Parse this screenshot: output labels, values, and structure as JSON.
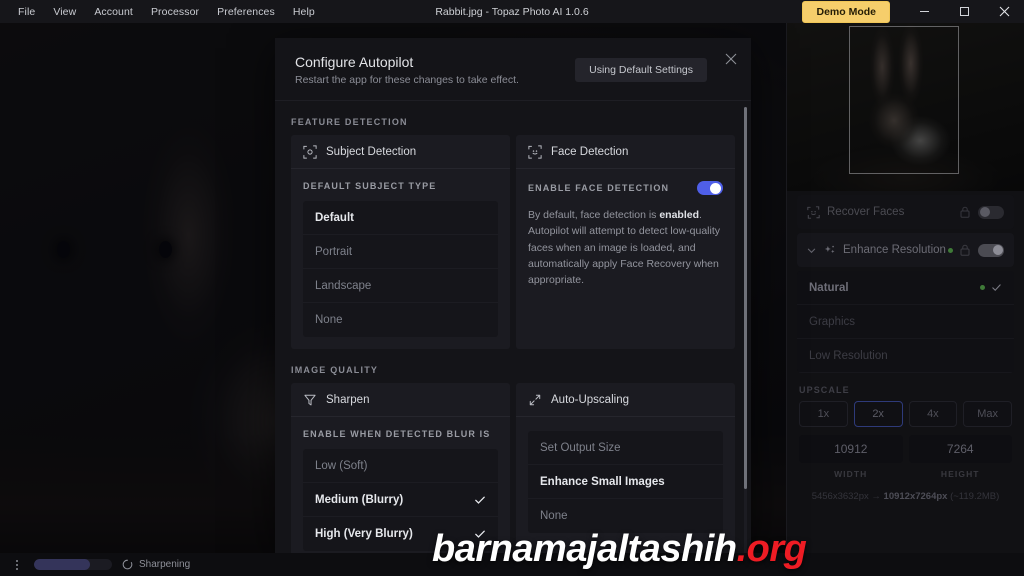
{
  "titlebar": {
    "menu": [
      "File",
      "View",
      "Account",
      "Processor",
      "Preferences",
      "Help"
    ],
    "window_title": "Rabbit.jpg - Topaz Photo AI 1.0.6",
    "demo_button": "Demo Mode",
    "minimize_icon": "minimize-icon",
    "maximize_icon": "maximize-icon",
    "close_icon": "close-icon"
  },
  "dialog": {
    "title": "Configure Autopilot",
    "subtitle": "Restart the app for these changes to take effect.",
    "default_settings_button": "Using Default Settings",
    "close_icon": "close-icon",
    "sections": {
      "feature_detection_label": "FEATURE DETECTION",
      "image_quality_label": "IMAGE QUALITY"
    },
    "subject_detection": {
      "icon": "subject-detection-icon",
      "title": "Subject Detection",
      "field_label": "DEFAULT SUBJECT TYPE",
      "options": [
        {
          "label": "Default",
          "selected": true
        },
        {
          "label": "Portrait",
          "selected": false
        },
        {
          "label": "Landscape",
          "selected": false
        },
        {
          "label": "None",
          "selected": false
        }
      ]
    },
    "face_detection": {
      "icon": "face-detection-icon",
      "title": "Face Detection",
      "field_label": "ENABLE FACE DETECTION",
      "toggle_on": true,
      "description_pre": "By default, face detection is ",
      "description_bold": "enabled",
      "description_post": ". Autopilot will attempt to detect low-quality faces when an image is loaded, and automatically apply Face Recovery when appropriate."
    },
    "sharpen": {
      "icon": "sharpen-icon",
      "title": "Sharpen",
      "field_label": "ENABLE WHEN DETECTED BLUR IS",
      "options": [
        {
          "label": "Low (Soft)",
          "selected": false
        },
        {
          "label": "Medium (Blurry)",
          "selected": true
        },
        {
          "label": "High (Very Blurry)",
          "selected": true
        }
      ]
    },
    "auto_upscaling": {
      "icon": "auto-upscaling-icon",
      "title": "Auto-Upscaling",
      "options": [
        {
          "label": "Set Output Size",
          "selected": false
        },
        {
          "label": "Enhance Small Images",
          "selected": true
        },
        {
          "label": "None",
          "selected": false
        }
      ]
    }
  },
  "right_panel": {
    "recover_faces": {
      "icon": "recover-faces-icon",
      "label": "Recover Faces",
      "lock_icon": "lock-icon",
      "toggle_on": false
    },
    "enhance_resolution": {
      "chevron_icon": "chevron-down-icon",
      "icon": "sparkle-icon",
      "label": "Enhance Resolution",
      "lock_icon": "lock-icon",
      "toggle_on": true,
      "options": [
        {
          "label": "Natural",
          "selected": true
        },
        {
          "label": "Graphics",
          "selected": false
        },
        {
          "label": "Low Resolution",
          "selected": false
        }
      ]
    },
    "upscale": {
      "label": "UPSCALE",
      "factors": [
        {
          "label": "1x",
          "active": false
        },
        {
          "label": "2x",
          "active": true
        },
        {
          "label": "4x",
          "active": false
        },
        {
          "label": "Max",
          "active": false
        }
      ],
      "width_value": "10912",
      "width_caption": "WIDTH",
      "height_value": "7264",
      "height_caption": "HEIGHT",
      "size_from": "5456x3632px",
      "size_arrow": "→",
      "size_to": "10912x7264px",
      "size_note": "(~119.2MB)"
    }
  },
  "statusbar": {
    "kebab_icon": "more-options-icon",
    "progress_percent": 72,
    "spinner_icon": "spinner-icon",
    "status_text": "Sharpening"
  },
  "watermark": {
    "name": "barnamajaltashih",
    "tld": ".org"
  },
  "colors": {
    "accent_yellow": "#F6CE6B",
    "toggle_blue": "#4F5FE8",
    "status_green": "#3F7A38",
    "watermark_red": "#EE1C24",
    "dialog_bg": "#141418",
    "card_bg": "#1B1B21"
  }
}
